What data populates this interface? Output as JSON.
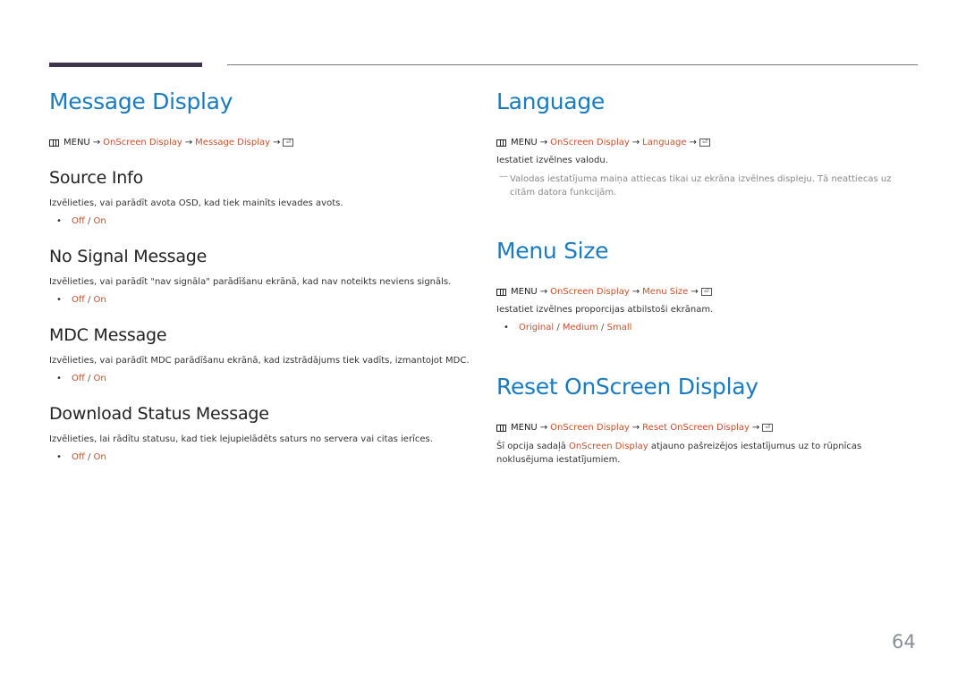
{
  "page_number": "64",
  "common": {
    "menu_label": "MENU",
    "arrow": "→",
    "onscreen_display": "OnScreen Display",
    "enter_glyph": "⏎"
  },
  "left": {
    "title": "Message Display",
    "path_target": "Message Display",
    "sections": [
      {
        "heading": "Source Info",
        "description": "Izvēlieties, vai parādīt avota OSD, kad tiek mainīts ievades avots.",
        "options": [
          "Off",
          "On"
        ]
      },
      {
        "heading": "No Signal Message",
        "description": "Izvēlieties, vai parādīt \"nav signāla\" parādīšanu ekrānā, kad nav noteikts neviens signāls.",
        "options": [
          "Off",
          "On"
        ]
      },
      {
        "heading": "MDC Message",
        "description": "Izvēlieties, vai parādīt MDC parādīšanu ekrānā, kad izstrādājums tiek vadīts, izmantojot MDC.",
        "options": [
          "Off",
          "On"
        ]
      },
      {
        "heading": "Download Status Message",
        "description": "Izvēlieties, lai rādītu statusu, kad tiek lejupielādēts saturs no servera vai citas ierīces.",
        "options": [
          "Off",
          "On"
        ]
      }
    ]
  },
  "right": {
    "language": {
      "title": "Language",
      "path_target": "Language",
      "description": "Iestatiet izvēlnes valodu.",
      "note": "Valodas iestatījuma maiņa attiecas tikai uz ekrāna izvēlnes displeju. Tā neattiecas uz citām datora funkcijām."
    },
    "menu_size": {
      "title": "Menu Size",
      "path_target": "Menu Size",
      "description": "Iestatiet izvēlnes proporcijas atbilstoši ekrānam.",
      "options": [
        "Original",
        "Medium",
        "Small"
      ]
    },
    "reset": {
      "title": "Reset OnScreen Display",
      "path_target": "Reset OnScreen Display",
      "description_before": "Šī opcija sadaļā ",
      "description_link": "OnScreen Display",
      "description_after": " atjauno pašreizējos iestatījumus uz to rūpnīcas noklusējuma iestatījumiem."
    }
  },
  "colors": {
    "title_blue": "#1a7bbf",
    "link_orange": "#c7502a",
    "top_bar": "#3d3549"
  }
}
